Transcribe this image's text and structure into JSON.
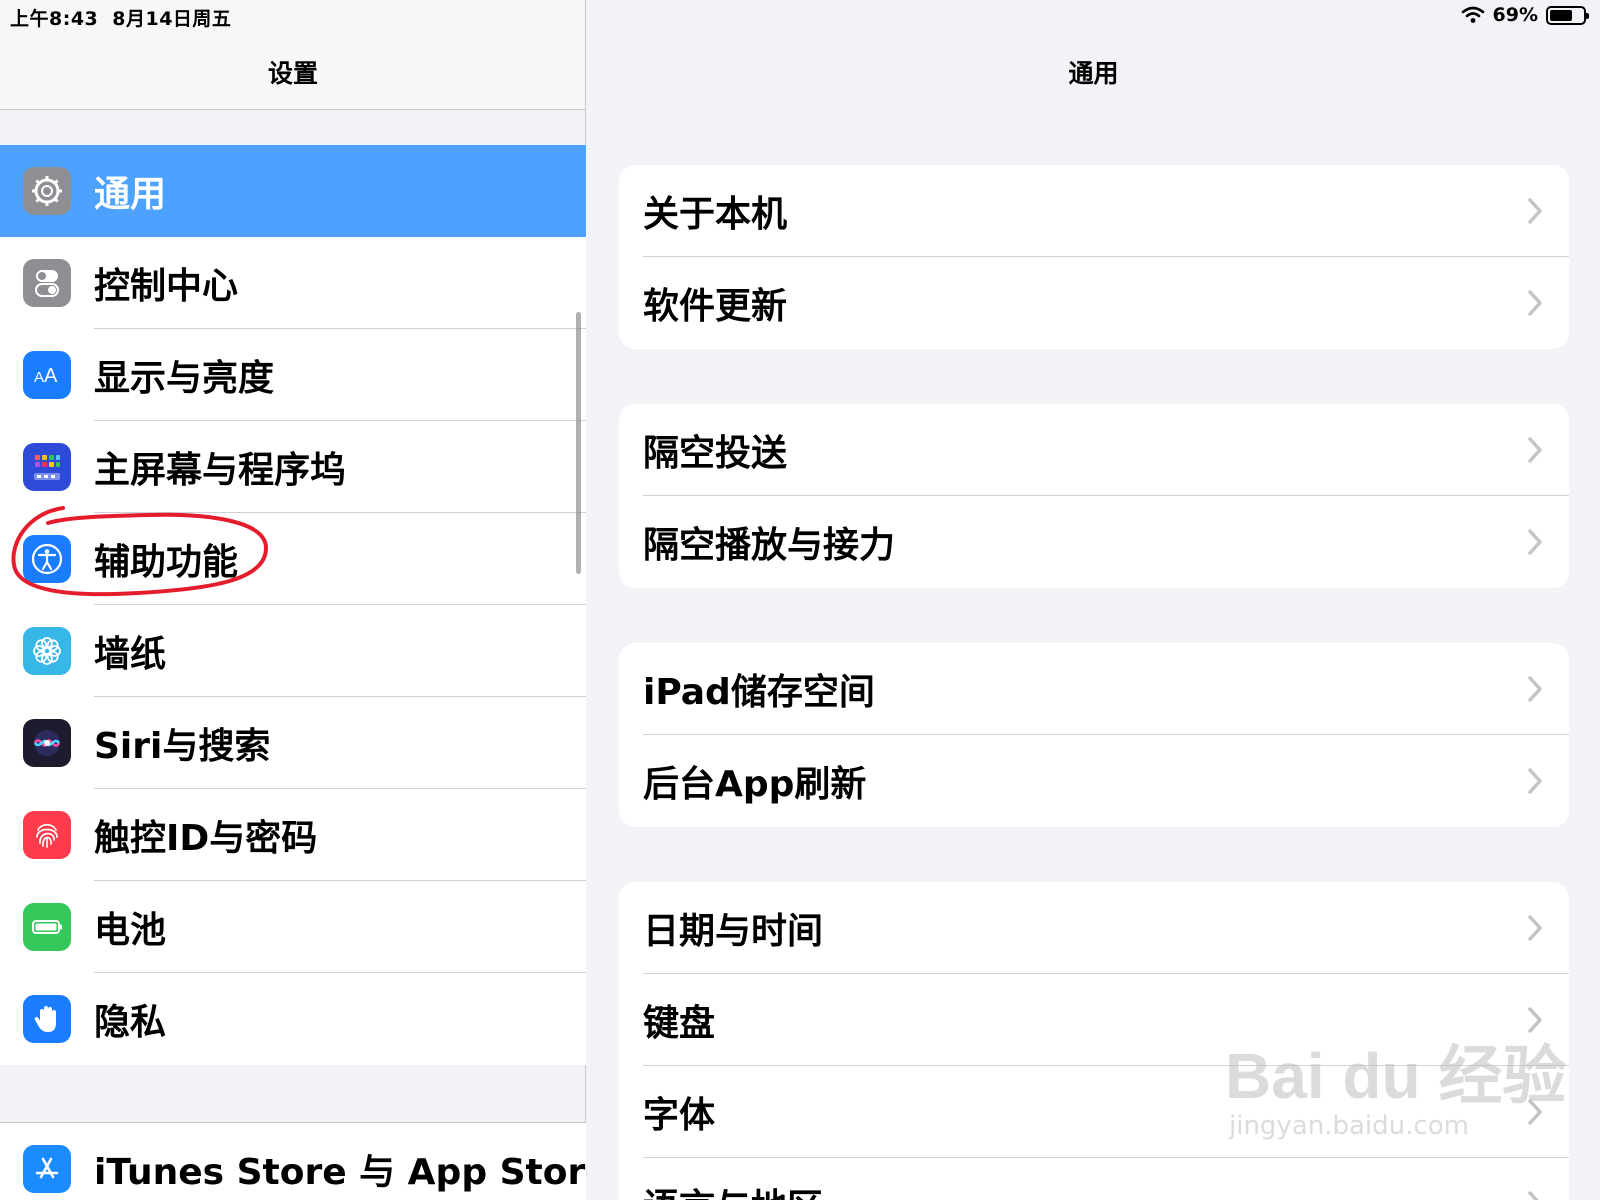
{
  "status_bar": {
    "time": "上午8:43",
    "date": "8月14日周五",
    "battery": "69%",
    "battery_level": 0.69
  },
  "sidebar": {
    "title": "设置",
    "items": [
      {
        "label": "通用",
        "icon": "gear-icon",
        "color": "#8e8e93",
        "selected": true
      },
      {
        "label": "控制中心",
        "icon": "toggle-icon",
        "color": "#8e8e93"
      },
      {
        "label": "显示与亮度",
        "icon": "text-size-icon",
        "color": "#1a7cff"
      },
      {
        "label": "主屏幕与程序坞",
        "icon": "home-grid-icon",
        "color": "#2d4bd6"
      },
      {
        "label": "辅助功能",
        "icon": "accessibility-icon",
        "color": "#1a7cff"
      },
      {
        "label": "墙纸",
        "icon": "flower-icon",
        "color": "#37b6e8"
      },
      {
        "label": "Siri与搜索",
        "icon": "siri-icon",
        "color": "#1c1c2e"
      },
      {
        "label": "触控ID与密码",
        "icon": "fingerprint-icon",
        "color": "#ff3b4e"
      },
      {
        "label": "电池",
        "icon": "battery-icon",
        "color": "#34c759"
      },
      {
        "label": "隐私",
        "icon": "hand-icon",
        "color": "#1a7cff"
      }
    ],
    "items2": [
      {
        "label": "iTunes Store 与 App Store",
        "icon": "app-store-icon",
        "color": "#1a8cff"
      }
    ]
  },
  "detail": {
    "title": "通用",
    "groups": [
      [
        "关于本机",
        "软件更新"
      ],
      [
        "隔空投送",
        "隔空播放与接力"
      ],
      [
        "iPad储存空间",
        "后台App刷新"
      ],
      [
        "日期与时间",
        "键盘",
        "字体",
        "语言与地区"
      ]
    ]
  },
  "watermark": {
    "main": "Bai du 经验",
    "sub": "jingyan.baidu.com"
  }
}
